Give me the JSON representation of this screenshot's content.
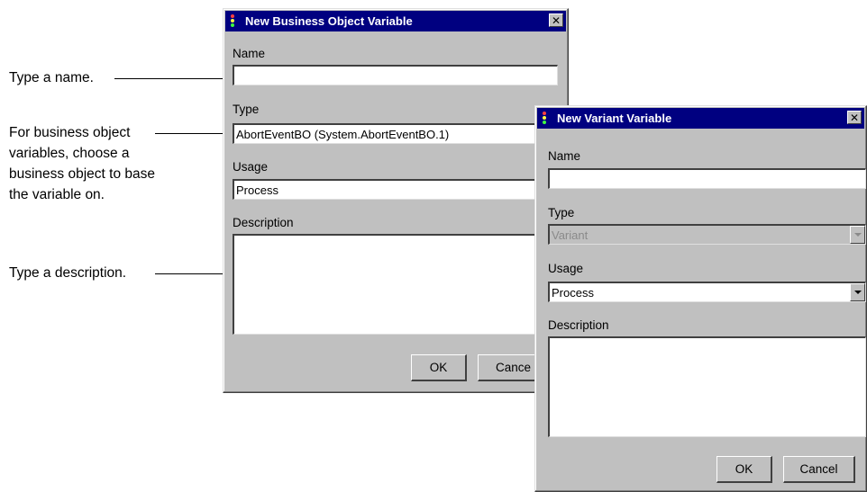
{
  "callouts": {
    "name": "Type a name.",
    "type_lines": [
      "For business object",
      "variables, choose a",
      "business object to base",
      "the variable on."
    ],
    "description": "Type a description."
  },
  "bo_dialog": {
    "title": "New Business Object Variable",
    "close_glyph": "✕",
    "name_label": "Name",
    "name_value": "",
    "type_label": "Type",
    "type_value": "AbortEventBO  (System.AbortEventBO.1)",
    "usage_label": "Usage",
    "usage_value": "Process",
    "description_label": "Description",
    "ok_label": "OK",
    "cancel_label": "Cance"
  },
  "variant_dialog": {
    "title": "New Variant Variable",
    "close_glyph": "✕",
    "name_label": "Name",
    "name_value": "",
    "type_label": "Type",
    "type_value": "Variant",
    "usage_label": "Usage",
    "usage_value": "Process",
    "description_label": "Description",
    "ok_label": "OK",
    "cancel_label": "Cancel"
  },
  "colors": {
    "titlebar": "#000080",
    "dialog_face": "#c0c0c0",
    "field": "#ffffff"
  },
  "icons": {
    "app": "traffic-light-icon",
    "close": "close-icon",
    "dropdown": "chevron-down-icon"
  }
}
